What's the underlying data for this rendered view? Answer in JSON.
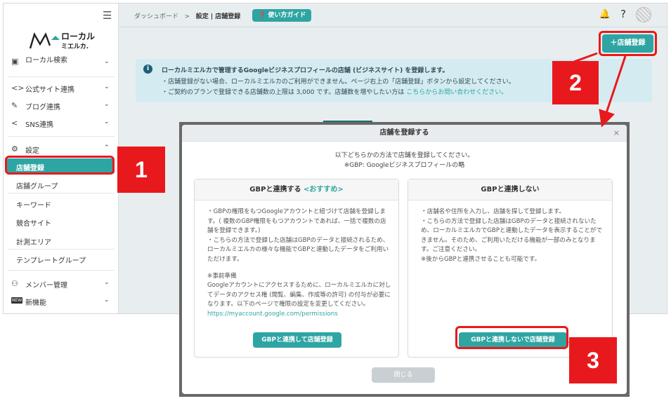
{
  "sidebar": {
    "logo": {
      "line1": "ローカル",
      "line2": "ミエルカ."
    },
    "items": [
      {
        "icon": "search-icon",
        "label": "ローカル検索"
      },
      {
        "icon": "code-icon",
        "label": "公式サイト連携"
      },
      {
        "icon": "pen-icon",
        "label": "ブログ連携"
      },
      {
        "icon": "share-icon",
        "label": "SNS連携"
      },
      {
        "icon": "gear-icon",
        "label": "設定"
      }
    ],
    "settings_sub": [
      "店舗登録",
      "店舗グループ",
      "キーワード",
      "競合サイト",
      "計測エリア",
      "テンプレートグループ"
    ],
    "bottom": [
      {
        "icon": "member-icon",
        "label": "メンバー管理"
      },
      {
        "icon": "new-icon",
        "label": "新機能",
        "badge": "NEW"
      }
    ]
  },
  "header": {
    "breadcrumb_home": "ダッシュボード",
    "breadcrumb_sep": ">",
    "breadcrumb_current": "設定 | 店舗登録",
    "help_label": "使い方ガイド"
  },
  "toolbar": {
    "add_store_label": "＋店舗登録"
  },
  "info": {
    "line1": "ローカルミエルカで管理するGoogleビジネスプロフィールの店舗 (ビジネスサイト) を登録します。",
    "line2": "・店舗登録がない場合、ローカルミエルカのご利用ができません。ページ右上の「店舗登録」ボタンから設定してください。",
    "line3_pre": "・ご契約のプランで登録できる店舗数の上限は 3,000 です。店舗数を増やしたい方は ",
    "line3_link": "こちらからお問い合わせください。"
  },
  "modal": {
    "title": "店舗を登録する",
    "close": "×",
    "desc1": "以下どちらかの方法で店舗を登録してください。",
    "desc2": "※GBP: Googleビジネスプロフィールの略",
    "left_card": {
      "title": "GBPと連携する",
      "recommend": "<おすすめ>",
      "p1": "・GBPの権限をもつGoogleアカウントと紐づけて店舗を登録します。( 複数のGBP権限をもつアカウントであれば、一括で複数の店舗を登録できます。)",
      "p2": "・こちらの方法で登録した店舗はGBPのデータと接続されるため、ローカルミエルカの様々な機能でGBPと連動したデータをご利用いただけます。",
      "p3_head": "※事前準備",
      "p3": "Googleアカウントにアクセスするために、ローカルミエルカに対してデータのアクセス権 (閲覧、編集、作成等の許可) の付与が必要になります。以下のページで権限の設定を変更してください。",
      "url": "https://myaccount.google.com/permissions",
      "button": "GBPと連携して店舗登録"
    },
    "right_card": {
      "title": "GBPと連携しない",
      "p1": "・店舗名や住所を入力し、店舗を探して登録します。",
      "p2": "・こちらの方法で登録した店舗はGBPのデータと接続されないため、ローカルミエルカでGBPと連動したデータを表示することができません。そのため、ご利用いただける機能が一部のみとなります。ご注意ください。",
      "p3": "※後からGBPと連携させることも可能です。",
      "button": "GBPと連携しないで店舗登録"
    },
    "close_button": "閉じる"
  },
  "annotations": {
    "step1": "1",
    "step2": "2",
    "step3": "3"
  },
  "colors": {
    "accent": "#2ea5a3",
    "annotation_red": "#e8191d",
    "info_bg": "#d4ecf1"
  }
}
